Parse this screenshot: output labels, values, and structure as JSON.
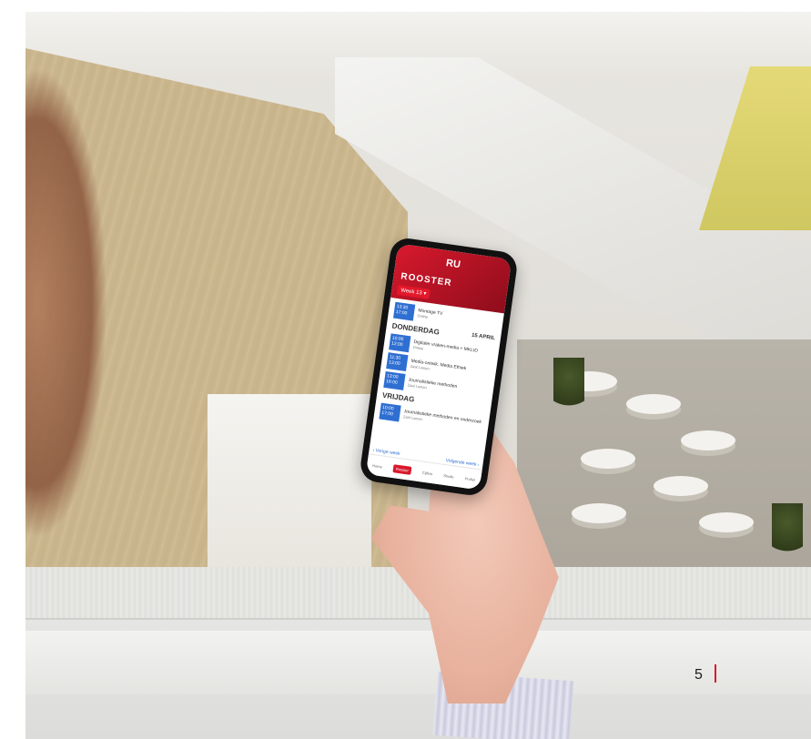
{
  "page": {
    "number": "5"
  },
  "phone_app": {
    "logo_text": "RU",
    "title": "ROOSTER",
    "week_button": "Week 13 ▾",
    "first_item": {
      "time": "13:30 17:00",
      "title": "Montage TV",
      "sub": "Online"
    },
    "days": [
      {
        "name": "DONDERDAG",
        "date": "15 APRIL",
        "items": [
          {
            "time": "10:00 12:00",
            "title": "Digitaler vraken-media + MKLID",
            "sub": "Online"
          },
          {
            "time": "11:30 13:00",
            "title": "Media-ontwik. Media Ethiek",
            "sub": "Zaal Lumen"
          },
          {
            "time": "13:00 16:00",
            "title": "Journalistieke methoden",
            "sub": "Zaal Lumen"
          }
        ]
      },
      {
        "name": "VRIJDAG",
        "date": "",
        "items": [
          {
            "time": "10:00 17:00",
            "title": "Journalistieke methoden en onderzoek",
            "sub": "Zaal Lumen"
          }
        ]
      }
    ],
    "prev_week": "‹ Vorige week",
    "next_week": "Volgende week ›",
    "nav": [
      "Home",
      "Rooster",
      "Cijfers",
      "Studie",
      "Profiel"
    ]
  }
}
